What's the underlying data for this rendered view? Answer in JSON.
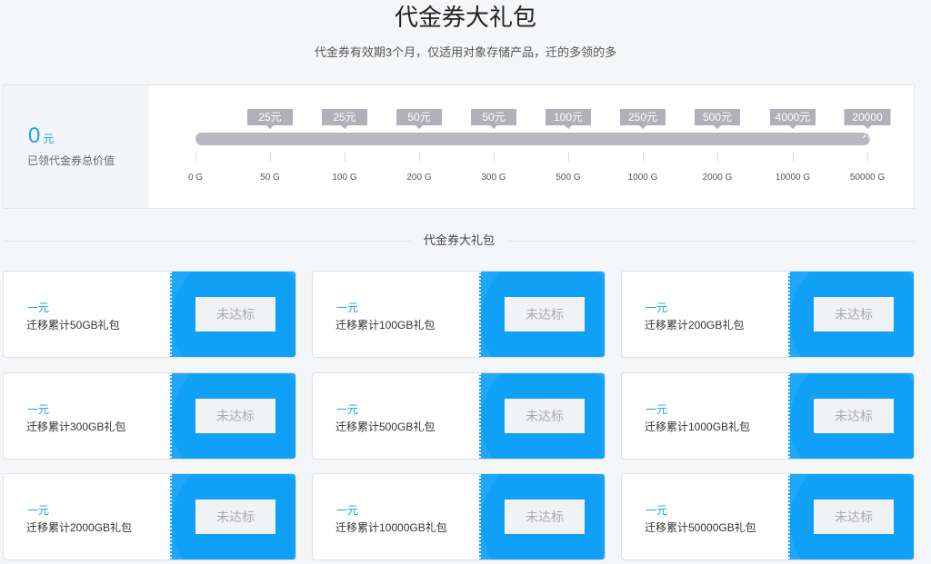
{
  "header": {
    "title": "代金券大礼包",
    "subtitle": "代金券有效期3个月，仅适用对象存储产品，迁的多领的多"
  },
  "summary": {
    "total_value": "0",
    "unit": "元",
    "label": "已领代金券总价值"
  },
  "progress": {
    "rewards": [
      "25元",
      "25元",
      "50元",
      "50元",
      "100元",
      "250元",
      "500元",
      "4000元",
      "20000元"
    ],
    "ticks": [
      "0 G",
      "50 G",
      "100 G",
      "200 G",
      "300 G",
      "500 G",
      "1000 G",
      "2000 G",
      "10000 G",
      "50000 G"
    ]
  },
  "section": {
    "title": "代金券大礼包"
  },
  "coupons": [
    {
      "amount": "一元",
      "desc": "迁移累计50GB礼包",
      "status": "未达标"
    },
    {
      "amount": "一元",
      "desc": "迁移累计100GB礼包",
      "status": "未达标"
    },
    {
      "amount": "一元",
      "desc": "迁移累计200GB礼包",
      "status": "未达标"
    },
    {
      "amount": "一元",
      "desc": "迁移累计300GB礼包",
      "status": "未达标"
    },
    {
      "amount": "一元",
      "desc": "迁移累计500GB礼包",
      "status": "未达标"
    },
    {
      "amount": "一元",
      "desc": "迁移累计1000GB礼包",
      "status": "未达标"
    },
    {
      "amount": "一元",
      "desc": "迁移累计2000GB礼包",
      "status": "未达标"
    },
    {
      "amount": "一元",
      "desc": "迁移累计10000GB礼包",
      "status": "未达标"
    },
    {
      "amount": "一元",
      "desc": "迁移累计50000GB礼包",
      "status": "未达标"
    }
  ],
  "colors": {
    "accent": "#19a0f5",
    "coupon_stub": "#10a1f7",
    "badge": "#b0b0bb",
    "track": "#b8b8c2"
  }
}
